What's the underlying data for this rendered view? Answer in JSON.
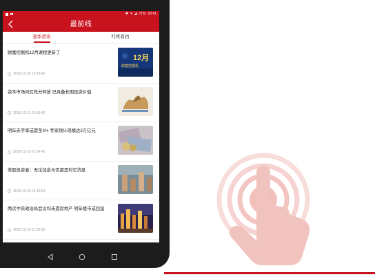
{
  "status_bar": {
    "battery": "71%",
    "time": "20:41"
  },
  "app_bar": {
    "title": "最前线"
  },
  "tabs": [
    {
      "label": "普华资讯",
      "selected": true
    },
    {
      "label": "叮咚有约",
      "selected": false
    }
  ],
  "feed": [
    {
      "headline": "财富挖掘机12月课程更新了",
      "date": "2018-12-29 10:28:42",
      "thumb_text": "12月",
      "thumb_sub": "财富挖掘机"
    },
    {
      "headline": "资本市场风险充分释放 已具备长期投资价值",
      "date": "2018-12-21 10:33:42"
    },
    {
      "headline": "明年赤字率或提至3% 专家预计规模达3万亿元",
      "date": "2018-12-20 01:24:42"
    },
    {
      "headline": "美股投资者：无论加息与否都是利空消息",
      "date": "2018-12-20 01:16:54"
    },
    {
      "headline": "两次中央政治局会议均未提房地产 明年楼市或回温",
      "date": "2018-12-18 11:20:58"
    }
  ],
  "theme": {
    "brand_red": "#c8121e",
    "touch_pink": "#f6d3d0"
  },
  "icons": [
    "back-arrow-icon",
    "wifi-icon",
    "signal-icon",
    "battery-icon",
    "clock-icon",
    "nav-back-icon",
    "nav-home-icon",
    "nav-recents-icon",
    "touch-gesture-icon"
  ]
}
